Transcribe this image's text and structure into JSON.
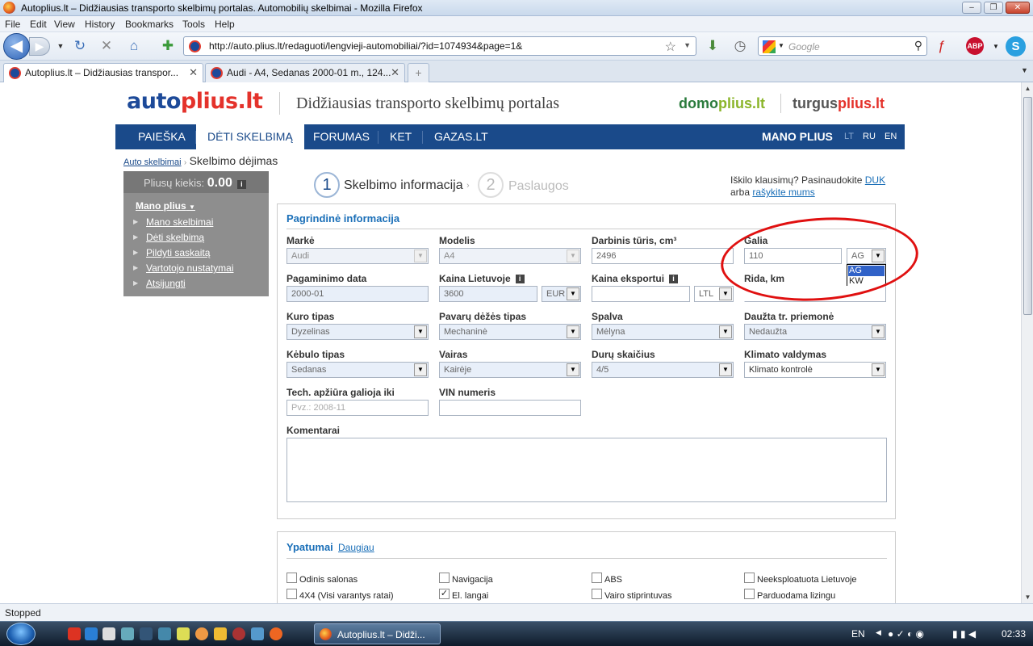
{
  "window": {
    "title": "Autoplius.lt – Didžiausias transporto skelbimų portalas. Automobilių skelbimai - Mozilla Firefox"
  },
  "menu": [
    "File",
    "Edit",
    "View",
    "History",
    "Bookmarks",
    "Tools",
    "Help"
  ],
  "url": "http://auto.plius.lt/redaguoti/lengvieji-automobiliai/?id=1074934&page=1&",
  "search_placeholder": "Google",
  "tabs": [
    {
      "label": "Autoplius.lt – Didžiausias transpor..."
    },
    {
      "label": "Audi - A4, Sedanas 2000-01 m., 124..."
    }
  ],
  "site": {
    "logo_a": "auto",
    "logo_b": "plius.lt",
    "tagline": "Didžiausias transporto skelbimų portalas",
    "sub1_a": "domo",
    "sub1_b": "plius.lt",
    "sub2_a": "turgus",
    "sub2_b": "plius.lt",
    "nav": [
      "PAIEŠKA",
      "DĖTI SKELBIMĄ",
      "FORUMAS",
      "KET",
      "GAZAS.LT"
    ],
    "mano": "MANO PLIUS",
    "langs": [
      "LT",
      "RU",
      "EN"
    ],
    "breadcrumb_link": "Auto skelbimai",
    "breadcrumb_sep": "›",
    "breadcrumb_current": "Skelbimo dėjimas"
  },
  "sidebar": {
    "count_label": "Pliusų kiekis:",
    "count_value": "0.00",
    "info": "i",
    "title": "Mano plius",
    "items": [
      "Mano skelbimai",
      "Dėti skelbimą",
      "Pildyti saskaitą",
      "Vartotojo nustatymai",
      "Atsijungti"
    ]
  },
  "steps": {
    "s1_num": "1",
    "s1_label": "Skelbimo informacija",
    "sep": "›",
    "s2_num": "2",
    "s2_label": "Paslaugos"
  },
  "help": {
    "text": "Iškilo klausimų? Pasinaudokite",
    "duk": "DUK",
    "arba": "arba",
    "write": "rašykite mums"
  },
  "form": {
    "section_title": "Pagrindinė informacija",
    "marke_label": "Markė",
    "marke_value": "Audi",
    "modelis_label": "Modelis",
    "modelis_value": "A4",
    "turis_label": "Darbinis tūris, cm³",
    "turis_value": "2496",
    "galia_label": "Galia",
    "galia_value": "110",
    "galia_unit": "AG",
    "galia_options": [
      "AG",
      "KW"
    ],
    "data_label": "Pagaminimo data",
    "data_value": "2000-01",
    "kaina_label": "Kaina Lietuvoje",
    "kaina_value": "3600",
    "kaina_cur": "EUR",
    "eksport_label": "Kaina eksportui",
    "eksport_value": "",
    "eksport_cur": "LTL",
    "rida_label": "Rida, km",
    "kuras_label": "Kuro tipas",
    "kuras_value": "Dyzelinas",
    "pavaru_label": "Pavarų dėžės tipas",
    "pavaru_value": "Mechaninė",
    "spalva_label": "Spalva",
    "spalva_value": "Mėlyna",
    "dauzta_label": "Daužta tr. priemonė",
    "dauzta_value": "Nedaužta",
    "kebulo_label": "Kėbulo tipas",
    "kebulo_value": "Sedanas",
    "vairas_label": "Vairas",
    "vairas_value": "Kairėje",
    "duru_label": "Durų skaičius",
    "duru_value": "4/5",
    "klimato_label": "Klimato valdymas",
    "klimato_value": "Klimato kontrolė",
    "tech_label": "Tech. apžiūra galioja iki",
    "tech_placeholder": "Pvz.: 2008-11",
    "vin_label": "VIN numeris",
    "komentarai_label": "Komentarai"
  },
  "features": {
    "title": "Ypatumai",
    "more": "Daugiau",
    "items": [
      {
        "label": "Odinis salonas",
        "checked": false
      },
      {
        "label": "Navigacija",
        "checked": false
      },
      {
        "label": "ABS",
        "checked": false
      },
      {
        "label": "Neeksploatuota Lietuvoje",
        "checked": false
      },
      {
        "label": "4X4 (Visi varantys ratai)",
        "checked": false
      },
      {
        "label": "El. langai",
        "checked": true
      },
      {
        "label": "Vairo stiprintuvas",
        "checked": false
      },
      {
        "label": "Parduodama lizingu",
        "checked": false
      }
    ]
  },
  "status": "Stopped",
  "taskbar": {
    "item": "Autoplius.lt – Didži...",
    "lang": "EN",
    "time": "02:33"
  }
}
